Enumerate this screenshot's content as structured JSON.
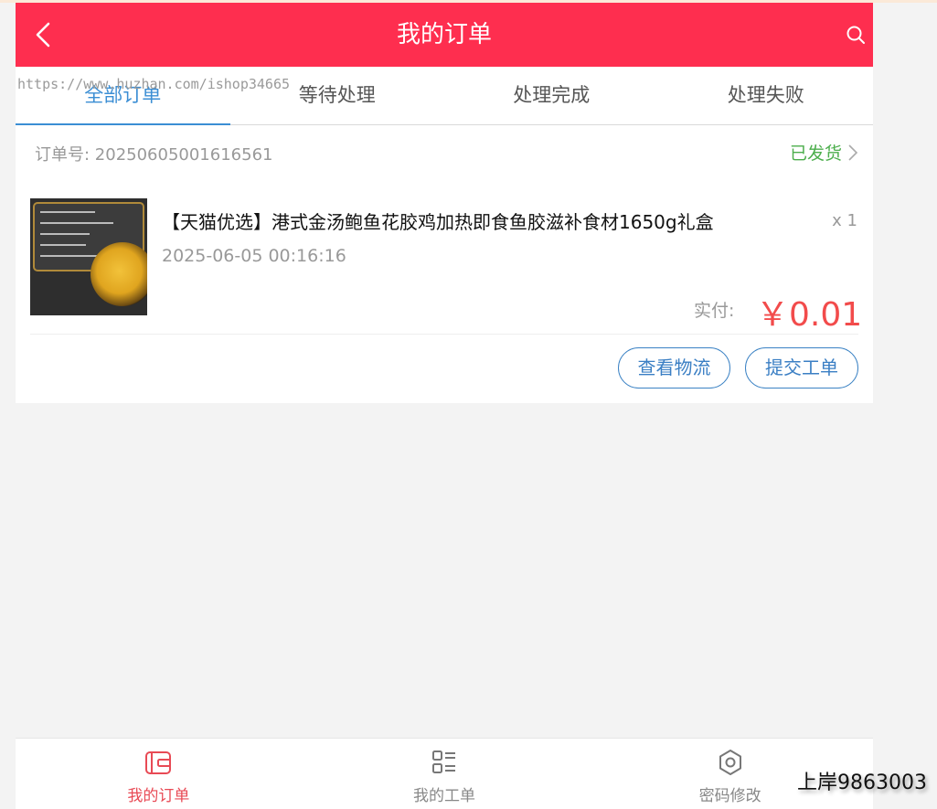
{
  "header": {
    "title": "我的订单",
    "back_icon": "chevron-left-icon",
    "search_icon": "search-icon"
  },
  "watermark": "https://www.huzhan.com/ishop34665",
  "tabs": [
    {
      "label": "全部订单",
      "active": true
    },
    {
      "label": "等待处理",
      "active": false
    },
    {
      "label": "处理完成",
      "active": false
    },
    {
      "label": "处理失败",
      "active": false
    }
  ],
  "order": {
    "number_label": "订单号: 20250605001616561",
    "status": "已发货",
    "product_name": "【天猫优选】港式金汤鲍鱼花胶鸡加热即食鱼胶滋补食材1650g礼盒",
    "quantity": "x 1",
    "time": "2025-06-05 00:16:16",
    "paid_label": "实付:",
    "paid_amount": "￥0.01",
    "buttons": {
      "logistics": "查看物流",
      "ticket": "提交工单"
    }
  },
  "bottom_nav": [
    {
      "label": "我的订单",
      "icon": "wallet-icon",
      "active": true
    },
    {
      "label": "我的工单",
      "icon": "list-icon",
      "active": false
    },
    {
      "label": "密码修改",
      "icon": "gear-icon",
      "active": false
    }
  ],
  "side_badge": "上岸9863003",
  "colors": {
    "header": "#fe2e4f",
    "tab_active": "#3b8ed4",
    "status": "#4cae4c",
    "price": "#f24b4b",
    "nav_active": "#e84a55"
  }
}
